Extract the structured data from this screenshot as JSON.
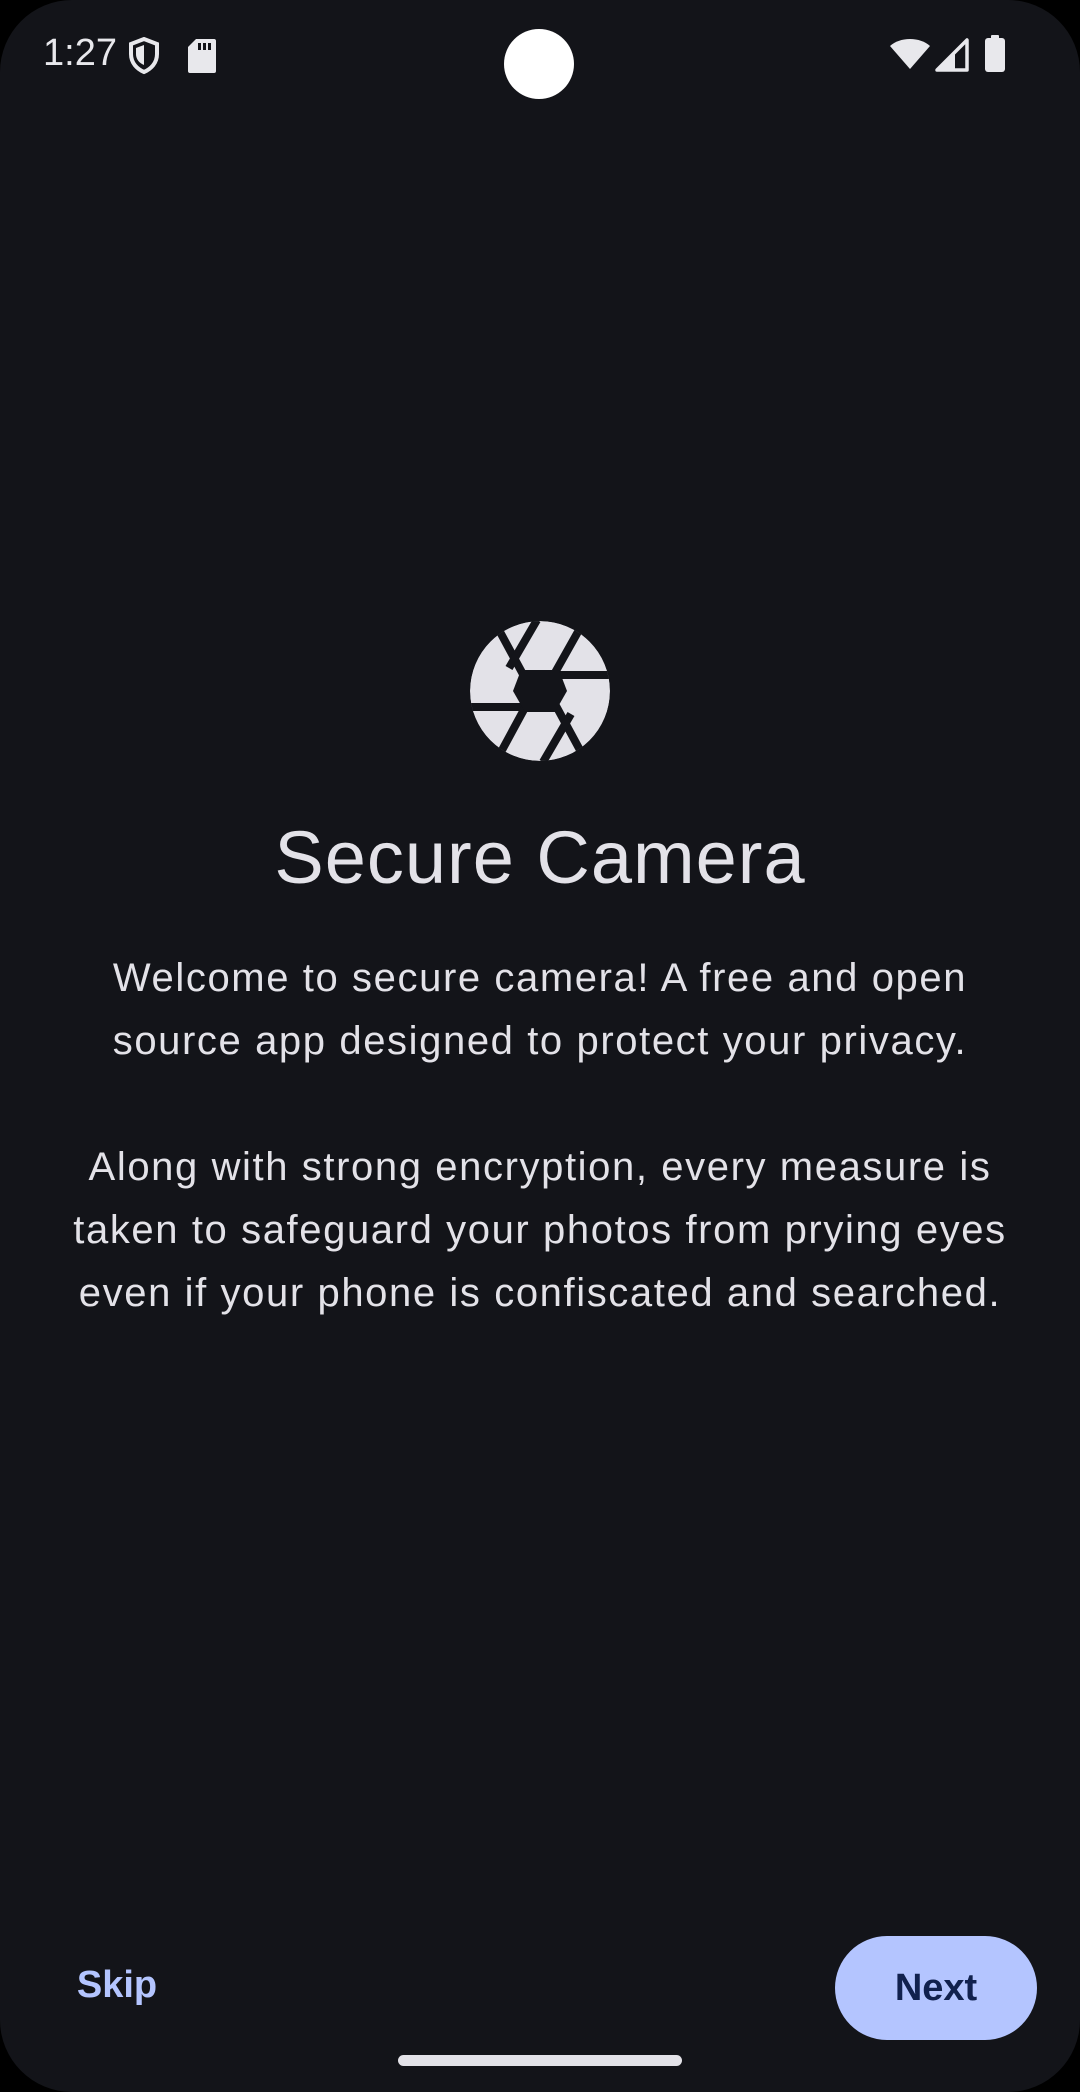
{
  "status_bar": {
    "time": "1:27",
    "left_icons": [
      "shield-icon",
      "sd-card-icon"
    ],
    "right_icons": [
      "wifi-icon",
      "signal-icon",
      "battery-icon"
    ]
  },
  "onboarding": {
    "logo_icon": "aperture-icon",
    "title": "Secure Camera",
    "paragraph1_line1": "Welcome to secure camera! A free and open",
    "paragraph1_line2": "source app designed to protect your privacy.",
    "paragraph2_line1": "Along with strong encryption, every measure is",
    "paragraph2_line2": "taken to safeguard your photos from prying eyes",
    "paragraph2_line3": "even if your phone is confiscated and searched."
  },
  "actions": {
    "skip_label": "Skip",
    "next_label": "Next"
  },
  "colors": {
    "background": "#131419",
    "text": "#e3e2e8",
    "accent": "#b4c5ff",
    "on_accent": "#11214e"
  }
}
